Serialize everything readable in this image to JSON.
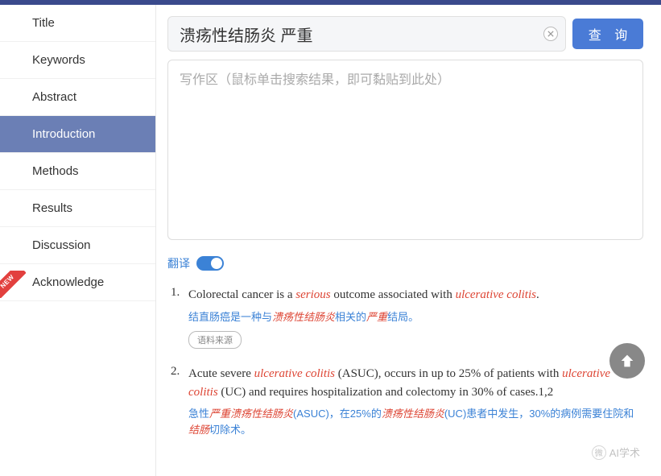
{
  "sidebar": {
    "items": [
      {
        "label": "Title"
      },
      {
        "label": "Keywords"
      },
      {
        "label": "Abstract"
      },
      {
        "label": "Introduction"
      },
      {
        "label": "Methods"
      },
      {
        "label": "Results"
      },
      {
        "label": "Discussion"
      },
      {
        "label": "Acknowledge"
      }
    ],
    "active_index": 3,
    "new_badge": "NEW"
  },
  "search": {
    "value": "溃疡性结肠炎 严重",
    "query_button": "查 询"
  },
  "writing_area": {
    "placeholder": "写作区（鼠标单击搜索结果，即可黏贴到此处）"
  },
  "translate": {
    "label": "翻译",
    "on": true
  },
  "results": [
    {
      "num": "1.",
      "en_pre": "Colorectal cancer is a ",
      "en_hl1": "serious",
      "en_mid": " outcome associated with ",
      "en_hl2": "ulcerative colitis",
      "en_post": ".",
      "cn_pre": "结直肠癌是一种与",
      "cn_hl1": "溃疡性结肠炎",
      "cn_mid": "相关的",
      "cn_hl2": "严重",
      "cn_post": "结局。",
      "source": "语料来源"
    },
    {
      "num": "2.",
      "en_pre": "Acute severe ",
      "en_hl1": "ulcerative colitis",
      "en_mid": " (ASUC), occurs in up to 25% of patients with ",
      "en_hl2": "ulcerative colitis",
      "en_post": " (UC) and requires hospitalization and colectomy in 30% of cases.1,2",
      "cn_pre": "急性",
      "cn_hl1": "严重溃疡性结肠炎",
      "cn_mid": "(ASUC)，在25%的",
      "cn_hl2": "溃疡性结肠炎",
      "cn_mid2": "(UC)患者中发生，30%的病例需要住院和",
      "cn_hl3": "结肠",
      "cn_post": "切除术。"
    }
  ],
  "watermark": "AI学术"
}
